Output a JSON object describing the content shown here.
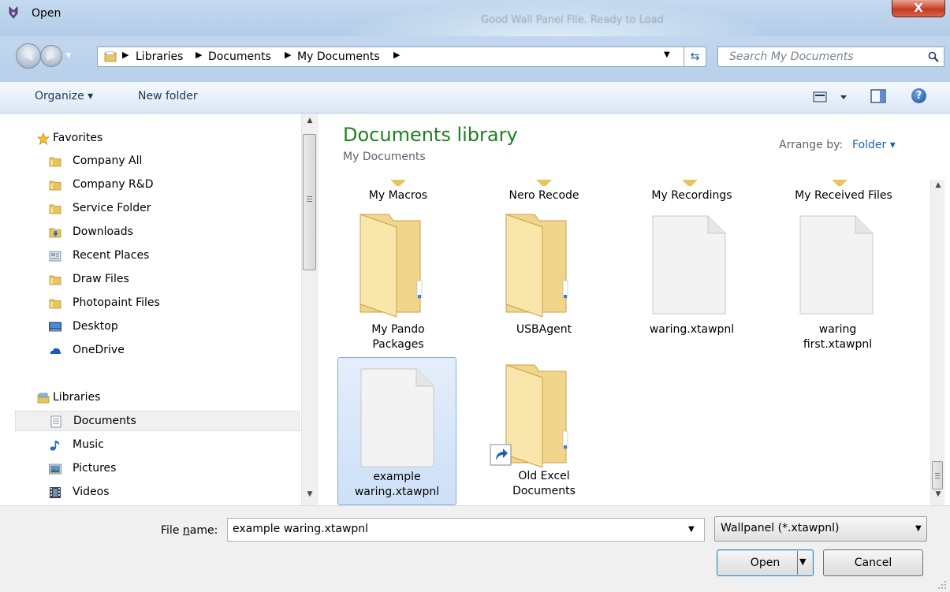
{
  "window": {
    "title": "Open",
    "background_status": "Good Wall Panel File. Ready to Load",
    "close_label": "X"
  },
  "navigation": {
    "back_icon": "back-arrow-icon",
    "forward_icon": "forward-arrow-icon",
    "breadcrumbs": [
      "Libraries",
      "Documents",
      "My Documents"
    ],
    "search_placeholder": "Search My Documents"
  },
  "toolbar": {
    "organize_label": "Organize ▾",
    "new_folder_label": "New folder"
  },
  "nav_pane": {
    "items": [
      {
        "label": "Favorites",
        "icon": "star-icon",
        "group": true
      },
      {
        "label": "Company All",
        "icon": "folder-icon"
      },
      {
        "label": "Company R&D",
        "icon": "folder-icon"
      },
      {
        "label": "Service Folder",
        "icon": "folder-icon"
      },
      {
        "label": "Downloads",
        "icon": "downloads-folder-icon"
      },
      {
        "label": "Recent Places",
        "icon": "recent-places-icon"
      },
      {
        "label": "Draw Files",
        "icon": "folder-icon"
      },
      {
        "label": "Photopaint Files",
        "icon": "folder-icon"
      },
      {
        "label": "Desktop",
        "icon": "desktop-icon"
      },
      {
        "label": "OneDrive",
        "icon": "onedrive-icon"
      },
      {
        "label": "Libraries",
        "icon": "libraries-icon",
        "group": true
      },
      {
        "label": "Documents",
        "icon": "documents-icon",
        "selected": true
      },
      {
        "label": "Music",
        "icon": "music-icon"
      },
      {
        "label": "Pictures",
        "icon": "pictures-icon"
      },
      {
        "label": "Videos",
        "icon": "videos-icon"
      }
    ]
  },
  "content": {
    "library_title": "Documents library",
    "library_subtitle": "My Documents",
    "arrange_label": "Arrange by:",
    "arrange_value": "Folder ▾",
    "top_row": [
      "My Macros",
      "Nero Recode",
      "My Recordings",
      "My Received Files"
    ],
    "items": [
      {
        "line1": "My Pando",
        "line2": "Packages",
        "kind": "folder"
      },
      {
        "line1": "USBAgent",
        "line2": "",
        "kind": "folder"
      },
      {
        "line1": "waring.xtawpnl",
        "line2": "",
        "kind": "file"
      },
      {
        "line1": "waring",
        "line2": "first.xtawpnl",
        "kind": "file"
      },
      {
        "line1": "example",
        "line2": "waring.xtawpnl",
        "kind": "file",
        "selected": true
      },
      {
        "line1": "Old Excel",
        "line2": "Documents",
        "kind": "folder-shortcut"
      }
    ]
  },
  "bottom": {
    "filename_label_prefix": "File ",
    "filename_label_accel": "n",
    "filename_label_suffix": "ame:",
    "filename_value": "example waring.xtawpnl",
    "filter_value": "Wallpanel (*.xtawpnl)",
    "open_label": "Open",
    "cancel_label": "Cancel"
  },
  "colors": {
    "accent_title_green": "#1e7f1e",
    "link_blue": "#1e5fb4",
    "selection_blue": "#cde0f7"
  }
}
